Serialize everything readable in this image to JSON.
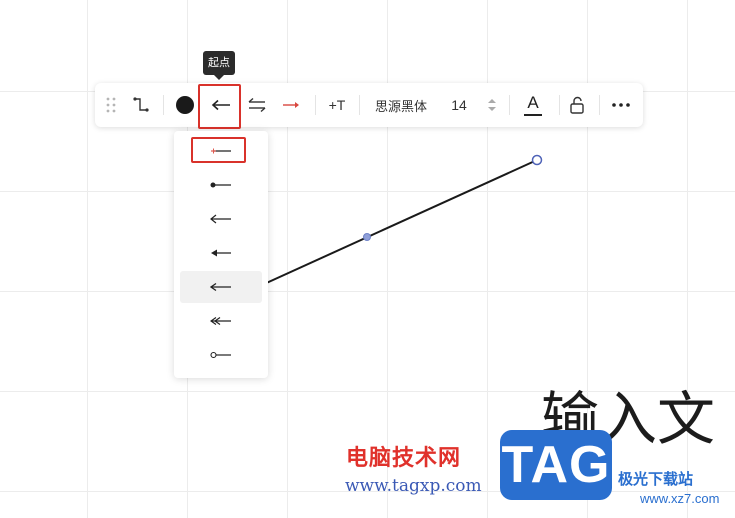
{
  "tooltip": {
    "label": "起点"
  },
  "toolbar": {
    "drag_handle_icon": "drag-handle-icon",
    "connector_style_icon": "connector-style-icon",
    "line_color": "#1a1a1a",
    "start_arrow_icon": "arrow-left-icon",
    "swap_direction_icon": "swap-direction-icon",
    "end_arrow_icon": "arrow-right-red-icon",
    "add_text_label": "+T",
    "font_name": "思源黑体",
    "font_size": "14",
    "font_color_label": "A",
    "lock_icon": "unlock-icon",
    "more_icon": "more-icon"
  },
  "start_marker_menu": {
    "items": [
      {
        "id": "none",
        "icon": "line-no-marker-icon",
        "highlighted": true
      },
      {
        "id": "filled-dot",
        "icon": "line-filled-dot-icon"
      },
      {
        "id": "open-arrow",
        "icon": "line-open-arrow-icon"
      },
      {
        "id": "filled-triangle",
        "icon": "line-filled-triangle-icon"
      },
      {
        "id": "arrow",
        "icon": "line-arrow-icon",
        "selected": true
      },
      {
        "id": "double-arrow",
        "icon": "line-double-arrow-icon"
      },
      {
        "id": "open-circle",
        "icon": "line-open-circle-icon"
      }
    ]
  },
  "canvas": {
    "text": "输入文",
    "connector_color": "#1a1a1a",
    "handle_color": "#4f63b8"
  },
  "watermark": {
    "cn_text": "电脑技术网",
    "url": "www.tagxp.com",
    "tag": "TAG",
    "site": "极光下载站",
    "site_url": "www.xz7.com"
  },
  "colors": {
    "highlight_border": "#d9322b",
    "accent_red": "#e0312b",
    "accent_blue": "#2a6fcf"
  }
}
